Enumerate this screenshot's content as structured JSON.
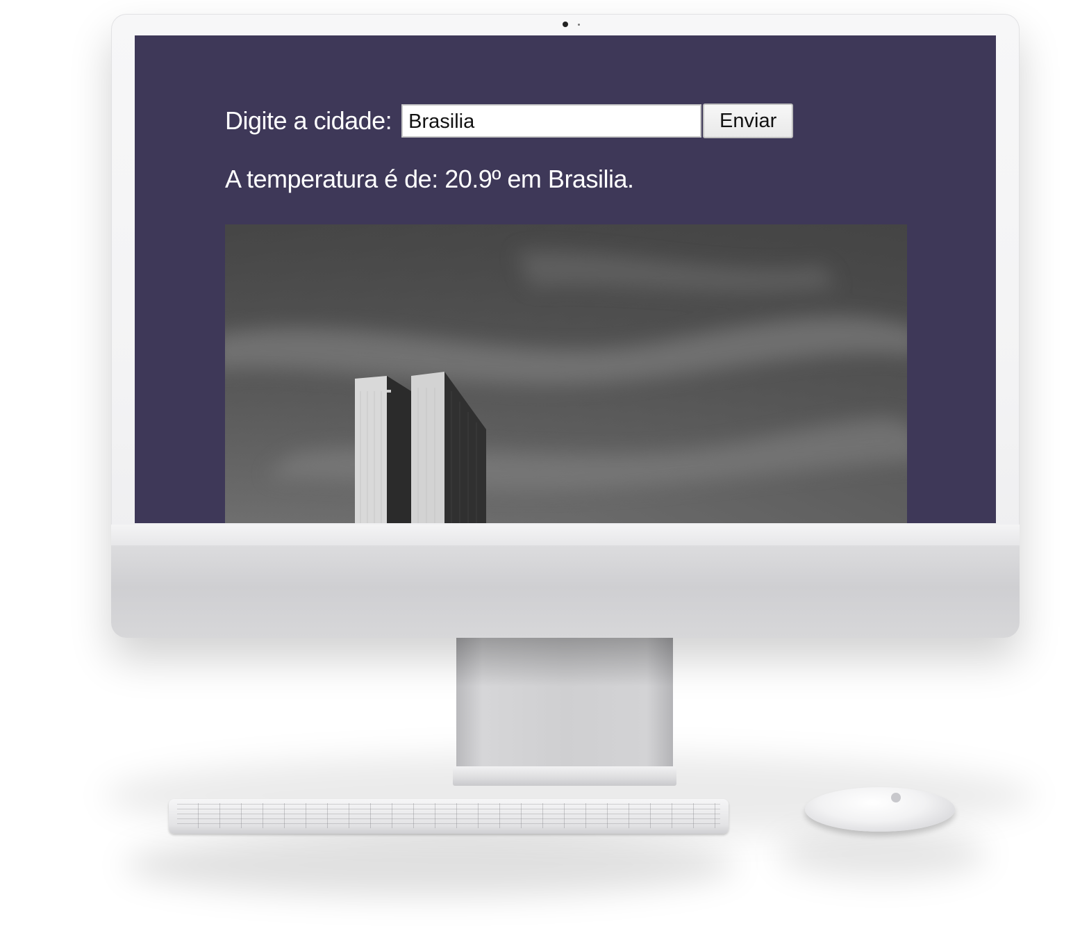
{
  "form": {
    "label": "Digite a cidade:",
    "city_value": "Brasilia",
    "send_label": "Enviar"
  },
  "result": {
    "text": "A temperatura é de: 20.9º em Brasilia."
  },
  "colors": {
    "page_background": "#3e3858",
    "text": "#ffffff"
  }
}
